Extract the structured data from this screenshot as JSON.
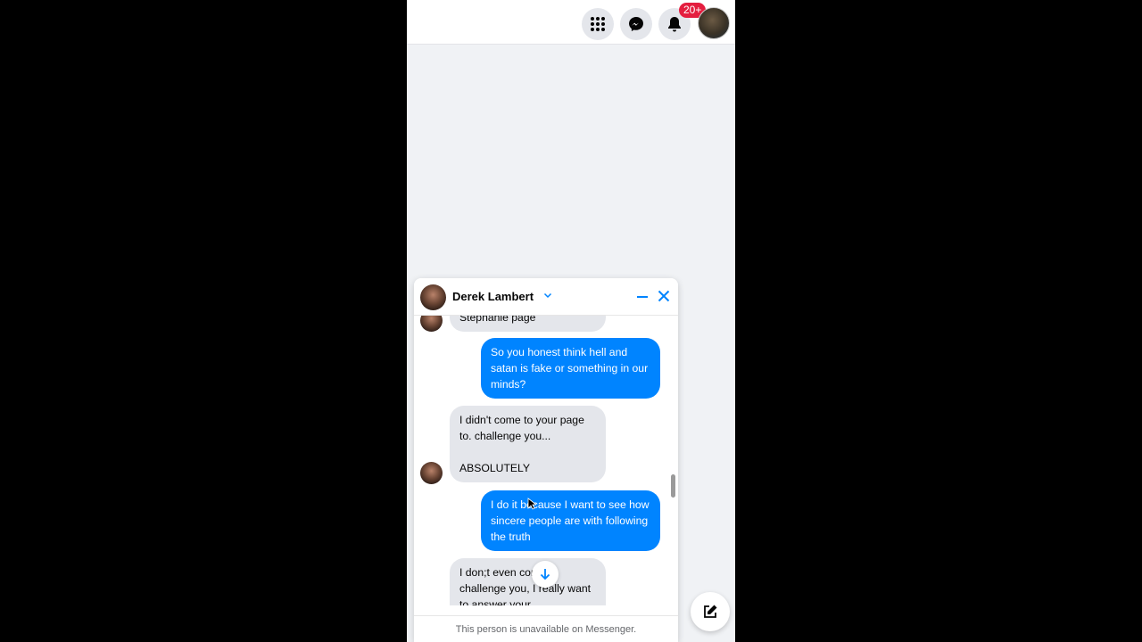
{
  "topbar": {
    "icons": [
      "menu-grid-icon",
      "messenger-icon",
      "bell-icon"
    ],
    "notification_badge": "20+"
  },
  "chat": {
    "contact_name": "Derek Lambert",
    "messages": [
      {
        "from": "them",
        "text": "Stephanie page"
      },
      {
        "from": "me",
        "text": "So you honest think hell and satan is fake or something in our minds?"
      },
      {
        "from": "them",
        "text": "I didn't come to your page to. challenge you...\n\nABSOLUTELY"
      },
      {
        "from": "me",
        "text": "I do it because I want to see how sincere people are with following the truth"
      },
      {
        "from": "them",
        "text": "I don;t even come to challenge you, I really want to answer your"
      }
    ],
    "footer_text": "This person is unavailable on Messenger."
  },
  "colors": {
    "outgoing_bubble": "#0084ff",
    "incoming_bubble": "#e4e6eb",
    "badge": "#e41e3f",
    "accent": "#0084ff"
  }
}
